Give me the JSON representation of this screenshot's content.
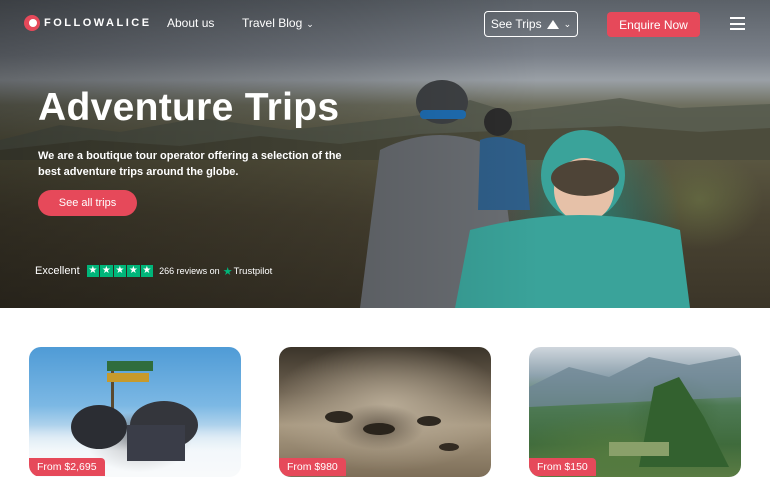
{
  "nav": {
    "logo_text": "FOLLOWALICE",
    "links": [
      {
        "label": "About us"
      },
      {
        "label": "Travel Blog"
      }
    ],
    "see_trips_label": "See Trips",
    "enquire_label": "Enquire Now",
    "icons": {
      "logo": "followalice-logo",
      "chevron": "chevron-down-icon",
      "mountain": "mountain-icon",
      "menu": "hamburger-menu-icon"
    }
  },
  "hero": {
    "title": "Adventure Trips",
    "subtitle": "We are a boutique tour operator offering a selection of the best adventure trips around the globe.",
    "button_label": "See all trips",
    "trustpilot": {
      "rating_label": "Excellent",
      "stars": 5,
      "reviews_text": "266 reviews on",
      "brand": "Trustpilot"
    }
  },
  "trips": [
    {
      "price": "From $2,695"
    },
    {
      "price": "From $980"
    },
    {
      "price": "From $150"
    }
  ],
  "colors": {
    "accent": "#e6495a",
    "trustpilot_green": "#00b67a",
    "text_light": "#ffffff"
  }
}
